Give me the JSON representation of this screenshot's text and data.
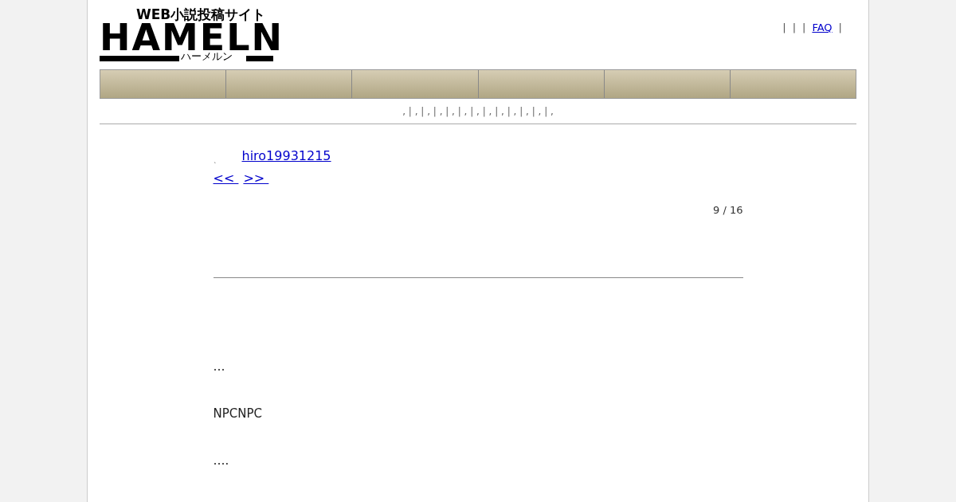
{
  "logo": {
    "tagline": "WEB小説投稿サイト",
    "wordmark": "HAMELN",
    "reading": "ハーメルン"
  },
  "top_links": [
    {
      "kind": "separator",
      "text": "|"
    },
    {
      "kind": "separator",
      "text": "|"
    },
    {
      "kind": "separator",
      "text": "|"
    },
    {
      "kind": "link",
      "text": "FAQ"
    },
    {
      "kind": "separator",
      "text": "|"
    }
  ],
  "sub_nav": ", | , | , | , | , | , | , | , | , | , | , | , | ,",
  "author": {
    "prefix": "、",
    "name": "hiro19931215"
  },
  "pager": [
    {
      "text": "<< "
    },
    {
      "text": ">> "
    }
  ],
  "page_count": "9 / 16",
  "body": [
    "…",
    "NPCNPC",
    "…."
  ]
}
